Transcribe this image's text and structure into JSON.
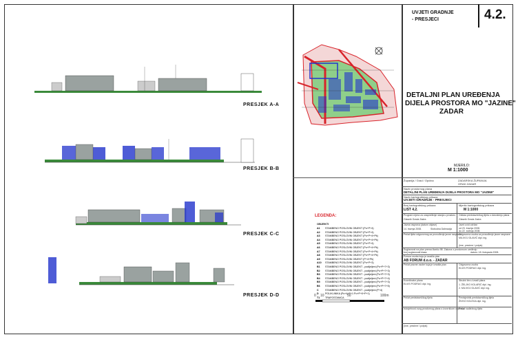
{
  "header": {
    "label_line1": "UVJETI GRADNJE",
    "label_line2": "- PRESJECI",
    "sheet_number": "4.2."
  },
  "plan_title": {
    "line1": "DETALJNI PLAN UREĐENJA",
    "line2": "DIJELA PROSTORA MO \"JAZINE\"",
    "line3": "ZADAR"
  },
  "scale_block": {
    "label": "MJERILO:",
    "value": "M 1:1000"
  },
  "sections": [
    {
      "label": "PRESJEK A-A"
    },
    {
      "label": "PRESJEK B-B"
    },
    {
      "label": "PRESJEK C-C"
    },
    {
      "label": "PRESJEK D-D"
    }
  ],
  "legend": {
    "title": "LEGENDA:",
    "subtitle": "OBJEKTI",
    "items": [
      {
        "code": "A1",
        "text": "STAMBENO POSLOVNI OBJEKT (Po+P+4)"
      },
      {
        "code": "A2",
        "text": "STAMBENO POSLOVNI OBJEKT (Po+P+4)"
      },
      {
        "code": "A3",
        "text": "STAMBENO POSLOVNI OBJEKT (Po+P+4+Pk)"
      },
      {
        "code": "A4",
        "text": "STAMBENO POSLOVNI OBJEKT (Po+P+4+Pk)"
      },
      {
        "code": "A5",
        "text": "STAMBENO POSLOVNI OBJEKT (Po+P+4)"
      },
      {
        "code": "A6",
        "text": "STAMBENO POSLOVNI OBJEKT (Po+P+4+Pk)"
      },
      {
        "code": "A7",
        "text": "STAMBENO POSLOVNI OBJEKT (Po+P+4+Pk)"
      },
      {
        "code": "A8",
        "text": "STAMBENO POSLOVNI OBJEKT (Po+P+4+Pk)"
      },
      {
        "code": "A9",
        "text": "STAMBENO POSLOVNI OBJEKT (P+4+Pk)"
      },
      {
        "code": "A10",
        "text": "STAMBENO POSLOVNI OBJEKT (Po+P+3)"
      },
      {
        "code": "B1",
        "text": "STAMBENO POSLOVNI OBJEKT - podijeljeni (Po+P+7+3)"
      },
      {
        "code": "B2",
        "text": "STAMBENO POSLOVNI OBJEKT - podijeljeni (Po+P+7+3)"
      },
      {
        "code": "B3",
        "text": "STAMBENO POSLOVNI OBJEKT - podijeljeni (Po+P+7+3)"
      },
      {
        "code": "B4",
        "text": "STAMBENO POSLOVNI OBJEKT - podijeljeni (Po+P+7+4)"
      },
      {
        "code": "B5",
        "text": "STAMBENO POSLOVNI OBJEKT - podijeljeni (Po+P+7+3)"
      },
      {
        "code": "B6",
        "text": "STAMBENO POSLOVNI OBJEKT - podijeljeni (Po+P+7+5)"
      },
      {
        "code": "C",
        "text": "STAMBENO POSLOVNI OBJEKT - podijeljeni (P+4)"
      },
      {
        "code": "D",
        "text": "POLIKLINIKA (Po+4+P+1 Po+P+0+P+1)"
      },
      {
        "code": "T1",
        "text": "TRAFOSTANICA"
      }
    ]
  },
  "scale_bar": {
    "labels": [
      "0",
      "10",
      "50",
      "100m"
    ]
  },
  "title_block": {
    "r1_left": "Županija / Grad / Općina",
    "r1_right_a": "ZADARSKA ŽUPANIJA",
    "r1_right_b": "GRAD ZADAR",
    "r2_label": "Naziv prostornog plana",
    "r2_value": "DETALJNI PLAN UREĐENJA DIJELA PROSTORA MO \"JAZINE\"",
    "r3_label": "Naziv kartografskog prikaza",
    "r3_value": "UVJETI GRADNJE - PRESJECI",
    "r4_left_label": "Broj kartografskog prikaza",
    "r4_left_value": "LIST 4.2.",
    "r4_right_label": "Mjerilo kartografskog prikaza",
    "r4_right_value": "M 1:1000",
    "r5_left": "Program mjera za unapređenje stanja u prostoru",
    "r5_left_b": "Glasnik Grada Zadra",
    "r5_right": "Odluka predstavničkog tijela o donošenju plana",
    "r5_right_b": "Glasnik Grada Zadra",
    "r6_left": "Javna rasprava (datum objave)",
    "r6_left_b": "14. travnja 2008.",
    "r6_left_c": "Slobodna Dalmacija",
    "r6_right": "Javni uvid održan",
    "r6_right_a": "od 23. travnja 2008.",
    "r6_right_b": "do 22. svibnja 2008.",
    "r7_left": "Pečat tijela odgovornog za provođenje javne rasprave",
    "r7_right": "Odgovorna osoba za provođenje javne rasprave",
    "r7_right_b": "MILIVOJ GLAVIĆ dipl. ing.",
    "r8_right": "(ime, prezime i potpis)",
    "r9_left": "Suglasnost na plan prema članku 98. Zakona o prostornom uređenju",
    "r9_left_b": "broj suglasnosti klasa",
    "r9_right": "datum: 18. listopada 2008.",
    "r10_label": "Pravna osoba koja je izradila plan",
    "r10_value": "AB FORUM d.o.o. - ZADAR",
    "r11_left": "Pečat pravne osobe koja je izradila plan",
    "r11_right": "Odgovorna osoba",
    "r11_right_b": "ELVIS PODRUG dipl. ing.",
    "r12_left": "Koordinator plana",
    "r12_left_b": "ELVIS PODRUG dipl. ing.",
    "r12_right": "Stručni tim u izradi plana",
    "r12_right_a": "1. ŽELJKO KOLARIĆ dipl. ing.",
    "r12_right_b": "2. MILIVOJ GLAVIĆ dipl. ing.",
    "r13_left": "Pečat predstavničkog tijela",
    "r13_right": "Predsjednik predstavničkog tijela",
    "r13_right_b": "ŽIVKO KOLEGA dipl. ing.",
    "r14_left": "Istovjetnost ovog prostornog plana s izvornikom ovjerava",
    "r14_right": "Pečat nadležnog tijela",
    "r15_left": "(ime, prezime i potpis)"
  },
  "colors": {
    "building_blue": "#2233cc",
    "hatch_grey": "#9aa2a0",
    "ground_green": "#3a8a3a",
    "road_red": "#d8232a",
    "map_green": "#8fcf8a"
  }
}
